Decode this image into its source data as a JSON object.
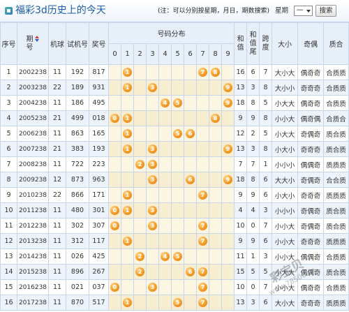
{
  "header": {
    "icon": "lottery-icon",
    "title": "福彩3d历史上的今天",
    "note": "(注：可以分别按星期，月日，期数搜索)",
    "weekday_label": "星期",
    "weekday_value": "一",
    "search_label": "搜索"
  },
  "colors": {
    "title": "#1d5ea8",
    "ball": "#f39a28",
    "distribution_bg": "#fbf5e1",
    "header_bg": "#e7eff8",
    "row_stripe": "#edf3fa"
  },
  "table": {
    "columns": {
      "index": "序号",
      "period": "期号",
      "machine": "机球",
      "test": "试机号",
      "draw": "奖号",
      "distribution": "号码分布",
      "sum": "和值",
      "sum_tail": "和值尾",
      "span": "跨度",
      "size": "大小",
      "parity": "奇偶",
      "prime": "质合"
    },
    "sort_icon": "sort-icon",
    "digits": [
      "0",
      "1",
      "2",
      "3",
      "4",
      "5",
      "6",
      "7",
      "8",
      "9"
    ],
    "rows": [
      {
        "index": "1",
        "period": "2002238",
        "machine": "11",
        "test": "192",
        "draw": "817",
        "sum": "16",
        "sum_tail": "6",
        "span": "7",
        "size": "大小大",
        "parity": "偶奇奇",
        "prime": "合质质"
      },
      {
        "index": "2",
        "period": "2003238",
        "machine": "22",
        "test": "189",
        "draw": "931",
        "sum": "13",
        "sum_tail": "3",
        "span": "8",
        "size": "大小小",
        "parity": "奇奇奇",
        "prime": "合质质"
      },
      {
        "index": "3",
        "period": "2004238",
        "machine": "11",
        "test": "186",
        "draw": "495",
        "sum": "18",
        "sum_tail": "8",
        "span": "5",
        "size": "小大大",
        "parity": "偶奇奇",
        "prime": "合质质"
      },
      {
        "index": "4",
        "period": "2005238",
        "machine": "21",
        "test": "499",
        "draw": "018",
        "sum": "9",
        "sum_tail": "9",
        "span": "8",
        "size": "小小大",
        "parity": "偶奇偶",
        "prime": "合质合"
      },
      {
        "index": "5",
        "period": "2006238",
        "machine": "11",
        "test": "863",
        "draw": "165",
        "sum": "12",
        "sum_tail": "2",
        "span": "5",
        "size": "小大大",
        "parity": "奇偶奇",
        "prime": "质合质"
      },
      {
        "index": "6",
        "period": "2007238",
        "machine": "21",
        "test": "383",
        "draw": "193",
        "sum": "13",
        "sum_tail": "3",
        "span": "8",
        "size": "小大小",
        "parity": "奇奇奇",
        "prime": "质合质"
      },
      {
        "index": "7",
        "period": "2008238",
        "machine": "11",
        "test": "722",
        "draw": "223",
        "sum": "7",
        "sum_tail": "7",
        "span": "1",
        "size": "小小小",
        "parity": "偶偶奇",
        "prime": "质质质"
      },
      {
        "index": "8",
        "period": "2009238",
        "machine": "12",
        "test": "873",
        "draw": "963",
        "sum": "18",
        "sum_tail": "8",
        "span": "6",
        "size": "大大小",
        "parity": "奇偶奇",
        "prime": "合合质"
      },
      {
        "index": "9",
        "period": "2010238",
        "machine": "22",
        "test": "866",
        "draw": "171",
        "sum": "9",
        "sum_tail": "9",
        "span": "6",
        "size": "小大小",
        "parity": "奇奇奇",
        "prime": "质质质"
      },
      {
        "index": "10",
        "period": "2011238",
        "machine": "11",
        "test": "480",
        "draw": "301",
        "sum": "4",
        "sum_tail": "4",
        "span": "3",
        "size": "小小小",
        "parity": "奇偶奇",
        "prime": "质合质"
      },
      {
        "index": "11",
        "period": "2012238",
        "machine": "11",
        "test": "302",
        "draw": "307",
        "sum": "10",
        "sum_tail": "0",
        "span": "7",
        "size": "小小大",
        "parity": "奇偶奇",
        "prime": "质合质"
      },
      {
        "index": "12",
        "period": "2013238",
        "machine": "11",
        "test": "312",
        "draw": "117",
        "sum": "9",
        "sum_tail": "9",
        "span": "6",
        "size": "小小大",
        "parity": "奇奇奇",
        "prime": "质质质"
      },
      {
        "index": "13",
        "period": "2014238",
        "machine": "11",
        "test": "026",
        "draw": "425",
        "sum": "11",
        "sum_tail": "1",
        "span": "3",
        "size": "小小大",
        "parity": "偶偶奇",
        "prime": "合质质"
      },
      {
        "index": "14",
        "period": "2015238",
        "machine": "11",
        "test": "896",
        "draw": "267",
        "sum": "15",
        "sum_tail": "5",
        "span": "5",
        "size": "小大大",
        "parity": "偶偶奇",
        "prime": "质合质"
      },
      {
        "index": "15",
        "period": "2016238",
        "machine": "11",
        "test": "021",
        "draw": "037",
        "sum": "10",
        "sum_tail": "0",
        "span": "7",
        "size": "小小大",
        "parity": "偶奇奇",
        "prime": "合质质"
      },
      {
        "index": "16",
        "period": "2017238",
        "machine": "11",
        "test": "870",
        "draw": "517",
        "sum": "13",
        "sum_tail": "3",
        "span": "6",
        "size": "大小大",
        "parity": "奇奇奇",
        "prime": "质质质"
      }
    ]
  },
  "watermark": {
    "brand": "彩宝贝",
    "site": "www.78500.cn"
  }
}
